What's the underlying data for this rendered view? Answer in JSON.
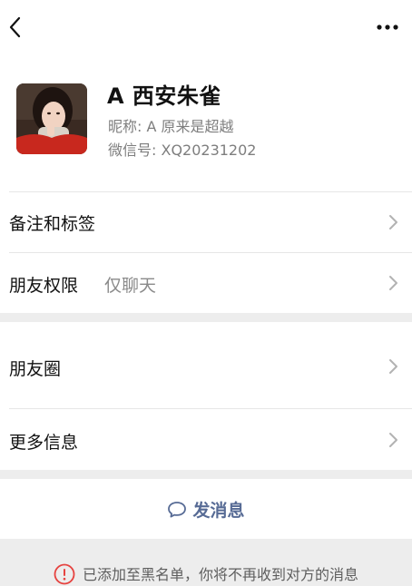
{
  "nav": {
    "back_icon": "chevron-left-icon",
    "more_icon": "more-dots-icon"
  },
  "profile": {
    "name": "A 西安朱雀",
    "nickname": "昵称: A 原来是超越",
    "wechat_id": "微信号: XQ20231202"
  },
  "menu": {
    "remark_label": "备注和标签",
    "permission_label": "朋友权限",
    "permission_value": "仅聊天",
    "moments_label": "朋友圈",
    "more_info_label": "更多信息"
  },
  "actions": {
    "send_message_label": "发消息",
    "send_icon": "chat-bubble-icon"
  },
  "notice": {
    "text": "已添加至黑名单，你将不再收到对方的消息",
    "icon": "warning-circle-icon"
  },
  "colors": {
    "link": "#576b95",
    "warning": "#e64340",
    "separator": "#ededed"
  }
}
